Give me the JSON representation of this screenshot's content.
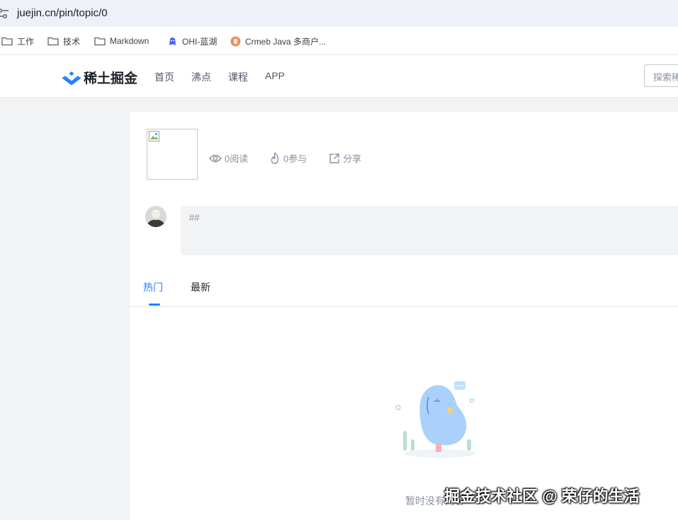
{
  "browser": {
    "url": "juejin.cn/pin/topic/0",
    "bookmarks": [
      {
        "label": "工作",
        "icon": "folder-icon"
      },
      {
        "label": "技术",
        "icon": "folder-icon"
      },
      {
        "label": "Markdown",
        "icon": "folder-icon"
      },
      {
        "label": "OHI-蓝湖",
        "icon": "lanhu-icon"
      },
      {
        "label": "Crmeb Java 多商户...",
        "icon": "crmeb-icon"
      }
    ]
  },
  "header": {
    "logo_text": "稀土掘金",
    "nav": [
      "首页",
      "沸点",
      "课程",
      "APP"
    ],
    "search_placeholder": "探索稀"
  },
  "topic": {
    "stats": {
      "reads": "0阅读",
      "participants": "0参与",
      "share": "分享"
    },
    "editor_text": "##"
  },
  "tabs": {
    "hot": "热门",
    "latest": "最新",
    "active": "hot"
  },
  "empty": {
    "text": "暂时没有内容"
  },
  "watermark": "掘金技术社区 @ 荣仔的生活",
  "colors": {
    "accent": "#1e80ff",
    "page_bg": "#f2f3f5",
    "text_primary": "#252933",
    "text_secondary": "#8a919f"
  }
}
